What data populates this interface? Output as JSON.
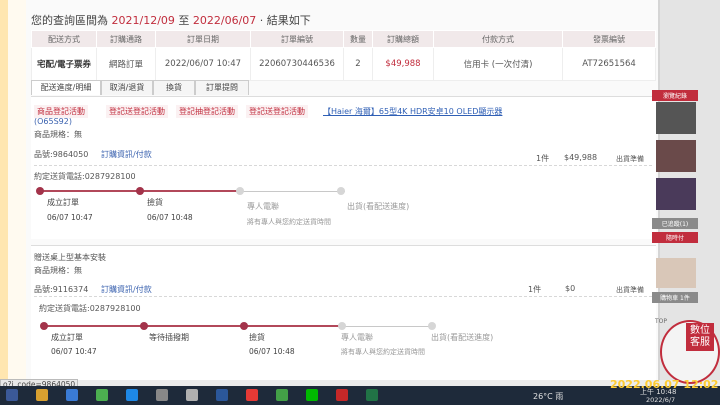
{
  "query_line": {
    "prefix": "您的查詢區間為 ",
    "start_date": "2021/12/09",
    "mid": " 至 ",
    "end_date": "2022/06/07",
    "suffix": " · 結果如下"
  },
  "order_table": {
    "headers": [
      "配送方式",
      "訂購通路",
      "訂單日期",
      "訂單編號",
      "數量",
      "訂購總額",
      "付款方式",
      "發票編號"
    ],
    "row": [
      "宅配/電子票券",
      "網路訂單",
      "2022/06/07 10:47",
      "22060730446536",
      "2",
      "$49,988",
      "信用卡 (一次付清)",
      "AT72651564"
    ]
  },
  "tabs": [
    "配送進度/明細",
    "取消/退貨",
    "換貨",
    "訂單提問"
  ],
  "item1": {
    "activities": [
      "商品登記活動",
      "登記送登記活動",
      "登記抽登記活動",
      "登記送登記活動"
    ],
    "product_link": "【Haier 海爾】65型4K HDR安卓10 OLED顯示器",
    "model": "(O65S92)",
    "spec": "商品規格：無",
    "item_no": "品號:9864050",
    "order_info": "訂購資訊/付款",
    "qty": "1件",
    "price": "$49,988",
    "ship_status": "出貨準備",
    "phone": "約定送貨電話:0287928100",
    "steps": [
      {
        "label": "成立訂單",
        "date": "06/07 10:47"
      },
      {
        "label": "撿貨",
        "date": "06/07 10:48"
      },
      {
        "label": "專人電聯",
        "note": "將有專人與您約定送貨時間"
      },
      {
        "label": "出貨(看配送進度)"
      }
    ]
  },
  "item2": {
    "title": "贈送桌上型基本安裝",
    "spec": "商品規格：無",
    "item_no": "品號:9116374",
    "order_info": "訂購資訊/付款",
    "qty": "1件",
    "price": "$0",
    "ship_status": "出貨準備",
    "phone": "約定送貨電話:0287928100",
    "steps": [
      {
        "label": "成立訂單",
        "date": "06/07 10:47"
      },
      {
        "label": "等待插撥期"
      },
      {
        "label": "撿貨",
        "date": "06/07 10:48"
      },
      {
        "label": "專人電聯",
        "note": "將有專人與您約定送貨時間"
      },
      {
        "label": "出貨(看配送進度)"
      }
    ]
  },
  "sidebar": {
    "labels": [
      "瀏覽紀錄",
      "已追蹤(1)",
      "隨時付",
      "購物車 1件"
    ],
    "top": "TOP",
    "chat": "數位客服"
  },
  "status_url": "o?i_code=9864050",
  "taskbar": {
    "weather": "26°C 雨",
    "time": "上午 10:48",
    "date": "2022/6/7"
  },
  "timestamp_overlay": "2022.06.07  12:02",
  "colors": {
    "accent": "#c12d3d",
    "track": "#a3334a",
    "link": "#3d64b0"
  }
}
